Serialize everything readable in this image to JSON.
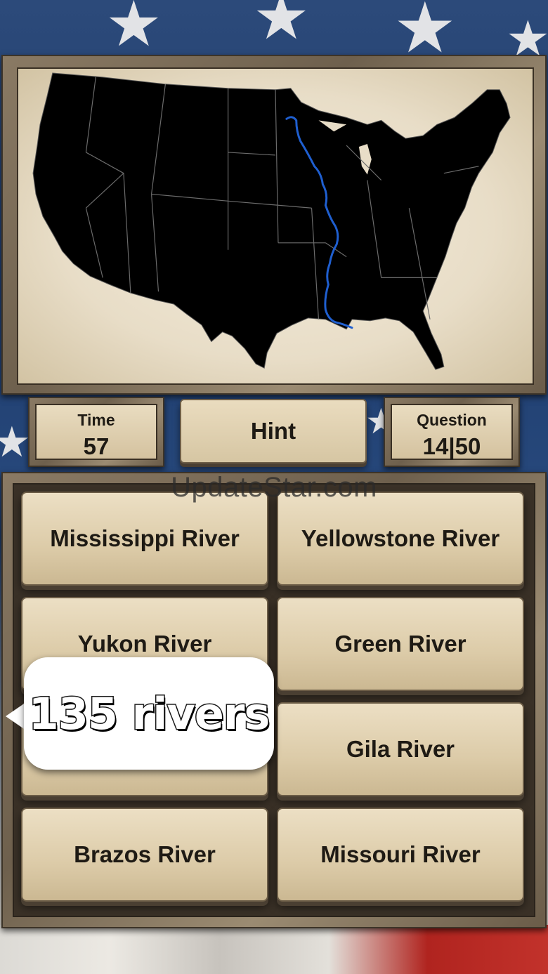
{
  "stats": {
    "time_label": "Time",
    "time_value": "57",
    "hint_label": "Hint",
    "question_label": "Question",
    "question_value": "14|50"
  },
  "map": {
    "highlighted_feature": "Mississippi River",
    "river_color": "#1f5fd0",
    "land_color": "#000000"
  },
  "answers": [
    "Mississippi River",
    "Yellowstone River",
    "Yukon River",
    "Green River",
    "",
    "Gila River",
    "Brazos River",
    "Missouri River"
  ],
  "overlay": {
    "watermark": "UpdateStar.com",
    "promo_bubble": "135 rivers"
  }
}
